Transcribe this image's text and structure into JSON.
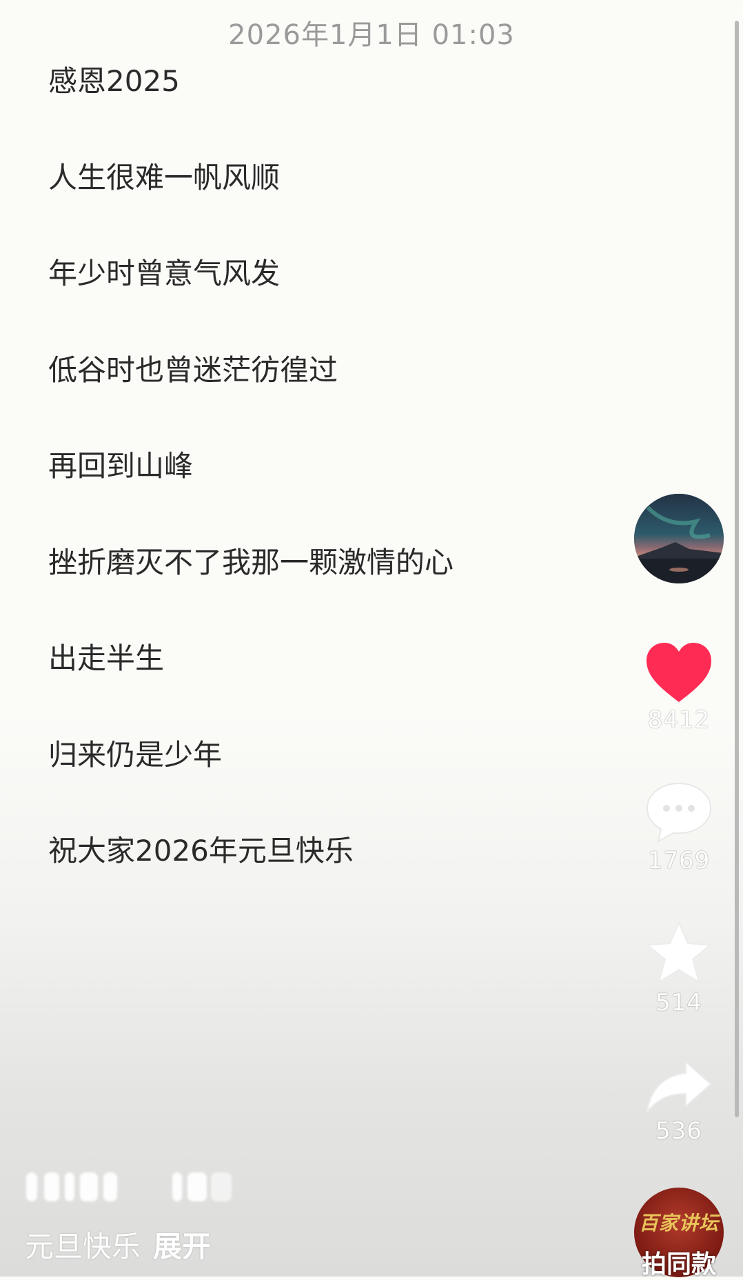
{
  "header": {
    "timestamp": "2026年1月1日 01:03"
  },
  "post": {
    "lines": [
      "感恩2025",
      "人生很难一帆风顺",
      "年少时曾意气风发",
      "低谷时也曾迷茫彷徨过",
      "再回到山峰",
      "挫折磨灭不了我那一颗激情的心",
      "出走半生",
      "归来仍是少年",
      "祝大家2026年元旦快乐"
    ]
  },
  "actions": {
    "avatar_icon": "author-avatar-landscape",
    "like": {
      "icon": "heart-icon",
      "count": "8412",
      "color": "#fe2c55"
    },
    "comment": {
      "icon": "comment-bubble-icon",
      "count": "1769"
    },
    "favorite": {
      "icon": "star-icon",
      "count": "514"
    },
    "share": {
      "icon": "share-arrow-icon",
      "count": "536"
    }
  },
  "caption": {
    "text": "元旦快乐",
    "expand_label": "展开"
  },
  "same_style": {
    "logo_text": "百家讲坛",
    "label": "拍同款"
  }
}
